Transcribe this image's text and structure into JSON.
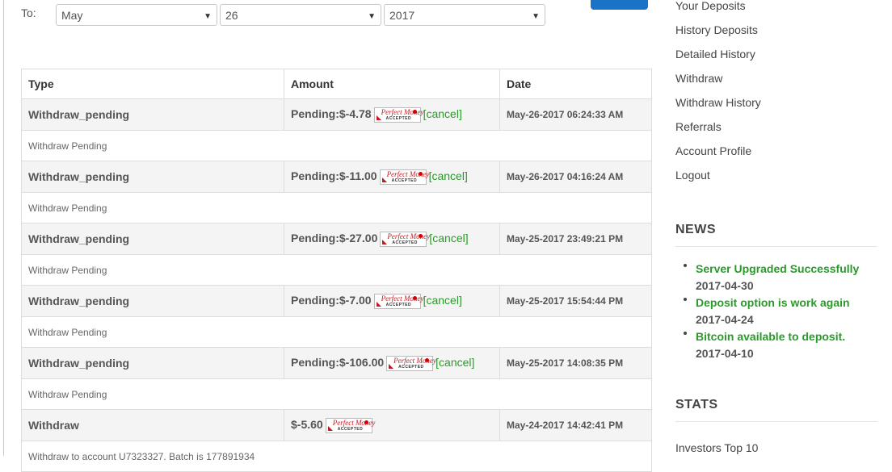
{
  "filter": {
    "to_label": "To:",
    "month": "May",
    "day": "26",
    "year": "2017"
  },
  "table": {
    "headers": [
      "Type",
      "Amount",
      "Date"
    ],
    "rows": [
      {
        "type": "Withdraw_pending",
        "amount": "Pending:$-4.78",
        "cancel": "[cancel]",
        "date": "May-26-2017 06:24:33 AM",
        "description": "Withdraw Pending"
      },
      {
        "type": "Withdraw_pending",
        "amount": "Pending:$-11.00",
        "cancel": "[cancel]",
        "date": "May-26-2017 04:16:24 AM",
        "description": "Withdraw Pending"
      },
      {
        "type": "Withdraw_pending",
        "amount": "Pending:$-27.00",
        "cancel": "[cancel]",
        "date": "May-25-2017 23:49:21 PM",
        "description": "Withdraw Pending"
      },
      {
        "type": "Withdraw_pending",
        "amount": "Pending:$-7.00",
        "cancel": "[cancel]",
        "date": "May-25-2017 15:54:44 PM",
        "description": "Withdraw Pending"
      },
      {
        "type": "Withdraw_pending",
        "amount": "Pending:$-106.00",
        "cancel": "[cancel]",
        "date": "May-25-2017 14:08:35 PM",
        "description": "Withdraw Pending"
      },
      {
        "type": "Withdraw",
        "amount": "$-5.60",
        "cancel": "",
        "date": "May-24-2017 14:42:41 PM",
        "description": "Withdraw to account U7323327. Batch is 177891934"
      }
    ],
    "badge": {
      "line1": "Perfect Money",
      "line2": "ACCEPTED"
    }
  },
  "sidebar": {
    "nav": [
      "Your Deposits",
      "History Deposits",
      "Detailed History",
      "Withdraw",
      "Withdraw History",
      "Referrals",
      "Account Profile",
      "Logout"
    ],
    "news_heading": "NEWS",
    "news": [
      {
        "title": "Server Upgraded Successfully",
        "date": "2017-04-30"
      },
      {
        "title": "Deposit option is work again",
        "date": "2017-04-24"
      },
      {
        "title": "Bitcoin available to deposit.",
        "date": "2017-04-10"
      }
    ],
    "stats_heading": "STATS",
    "stats_link": "Investors Top 10"
  },
  "colors": {
    "accent_blue": "#1a73c7",
    "cancel_green": "#2a9a2a",
    "news_green": "#2a9a2a",
    "perfect_money_red": "#c4161c"
  }
}
